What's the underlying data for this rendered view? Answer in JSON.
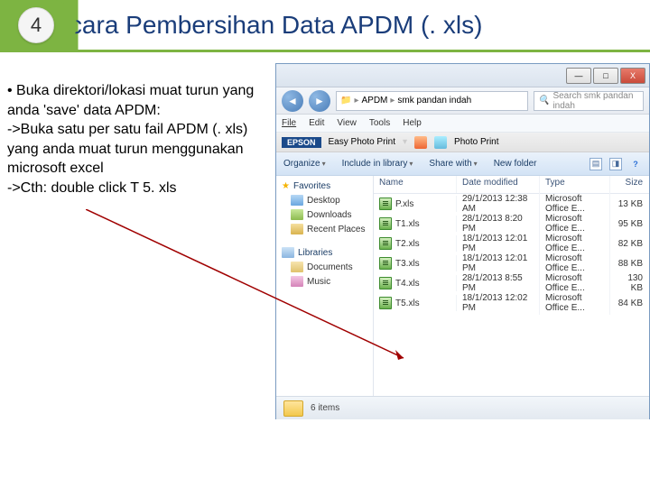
{
  "header": {
    "step_number": "4",
    "title": "Tatacara Pembersihan Data APDM (. xls)"
  },
  "instructions": "• Buka direktori/lokasi muat turun yang anda 'save' data APDM:\n  ->Buka satu per satu fail APDM (. xls) yang anda muat turun menggunakan microsoft excel\n->Cth: double click T 5. xls",
  "explorer": {
    "window_controls": {
      "min": "—",
      "max": "□",
      "close": "X"
    },
    "breadcrumb": [
      "APDM",
      "smk pandan indah"
    ],
    "search_placeholder": "Search smk pandan indah",
    "menu": [
      "File",
      "Edit",
      "View",
      "Tools",
      "Help"
    ],
    "epson": {
      "brand": "EPSON",
      "app": "Easy Photo Print",
      "btn": "Photo Print"
    },
    "toolbar": {
      "organize": "Organize",
      "include": "Include in library",
      "share": "Share with",
      "newfolder": "New folder"
    },
    "columns": {
      "name": "Name",
      "date": "Date modified",
      "type": "Type",
      "size": "Size"
    },
    "sidebar": {
      "favorites": "Favorites",
      "desktop": "Desktop",
      "downloads": "Downloads",
      "recent": "Recent Places",
      "libraries": "Libraries",
      "documents": "Documents",
      "music": "Music"
    },
    "files": [
      {
        "name": "P.xls",
        "date": "29/1/2013 12:38 AM",
        "type": "Microsoft Office E...",
        "size": "13 KB"
      },
      {
        "name": "T1.xls",
        "date": "28/1/2013 8:20 PM",
        "type": "Microsoft Office E...",
        "size": "95 KB"
      },
      {
        "name": "T2.xls",
        "date": "18/1/2013 12:01 PM",
        "type": "Microsoft Office E...",
        "size": "82 KB"
      },
      {
        "name": "T3.xls",
        "date": "18/1/2013 12:01 PM",
        "type": "Microsoft Office E...",
        "size": "88 KB"
      },
      {
        "name": "T4.xls",
        "date": "28/1/2013 8:55 PM",
        "type": "Microsoft Office E...",
        "size": "130 KB"
      },
      {
        "name": "T5.xls",
        "date": "18/1/2013 12:02 PM",
        "type": "Microsoft Office E...",
        "size": "84 KB"
      }
    ],
    "status": "6 items"
  }
}
